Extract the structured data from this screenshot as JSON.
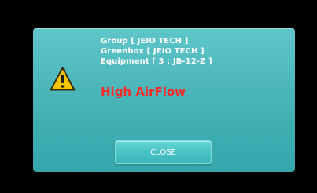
{
  "dialog": {
    "group_line": "Group [ JEIO TECH ]",
    "greenbox_line": "Greenbox [ JEIO TECH ]",
    "equipment_line": "Equipment [ 3 : JB-12-Z ]",
    "alarm_message": "High AirFlow",
    "close_label": "CLOSE",
    "icon": "warning-triangle-icon"
  },
  "colors": {
    "background": "#000000",
    "dialog": "#4fb9bd",
    "alarm_text": "#ff2a2a",
    "warning_fill": "#f2c400"
  }
}
